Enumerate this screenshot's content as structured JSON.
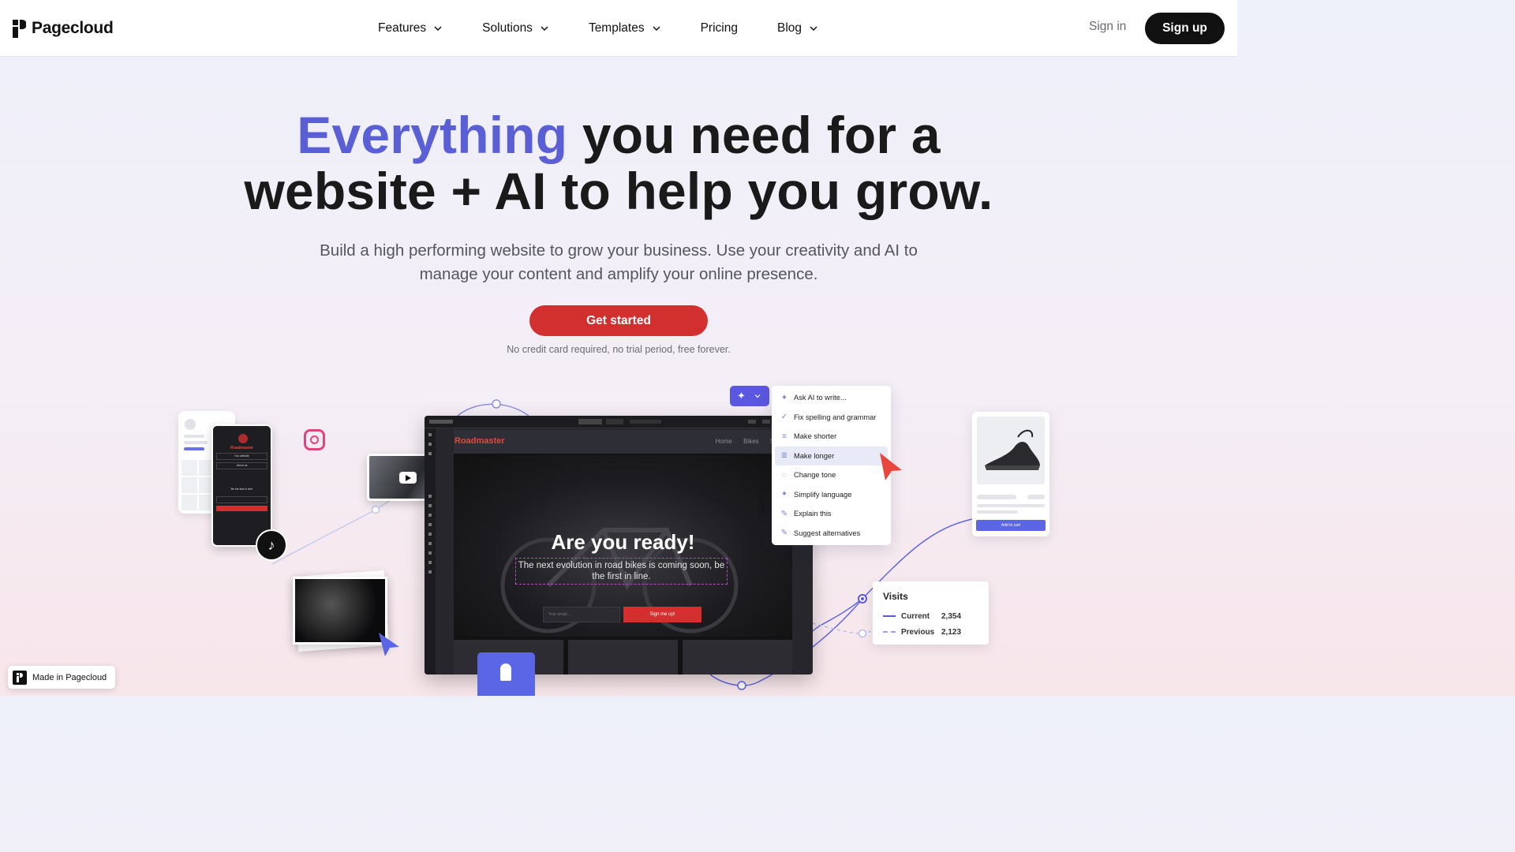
{
  "nav": {
    "brand": "Pagecloud",
    "items": [
      {
        "label": "Features",
        "has_dropdown": true
      },
      {
        "label": "Solutions",
        "has_dropdown": true
      },
      {
        "label": "Templates",
        "has_dropdown": true
      },
      {
        "label": "Pricing",
        "has_dropdown": false
      },
      {
        "label": "Blog",
        "has_dropdown": true
      }
    ],
    "signin": "Sign in",
    "signup": "Sign up"
  },
  "hero": {
    "title_accent": "Everything",
    "title_line1_rest": " you need for a",
    "title_line2": "website + AI to help you grow.",
    "subtitle": "Build a high performing website to grow your business. Use your creativity and AI to manage your content and amplify your online presence.",
    "cta": "Get started",
    "note": "No credit card required, no trial period, free forever."
  },
  "phone": {
    "brand": "Roadmaster",
    "rows": [
      "Our website",
      "About us",
      "Be the first in line!"
    ]
  },
  "editor": {
    "brand": "Roadmaster",
    "links": "Home Bikes Store",
    "headline": "Are you ready!",
    "paragraph": "The next evolution in road bikes is coming soon, be the first in line.",
    "email_placeholder": "Your email...",
    "signup_button": "Sign me up!"
  },
  "ai_menu": {
    "items": [
      {
        "label": "Ask AI to write...",
        "icon": "sparkle-icon"
      },
      {
        "label": "Fix spelling and grammar",
        "icon": "check-icon"
      },
      {
        "label": "Make shorter",
        "icon": "short-lines-icon"
      },
      {
        "label": "Make longer",
        "icon": "long-lines-icon",
        "active": true
      },
      {
        "label": "Change tone",
        "icon": "tone-icon"
      },
      {
        "label": "Simplify language",
        "icon": "sparkle-icon"
      },
      {
        "label": "Explain this",
        "icon": "pencil-icon"
      },
      {
        "label": "Suggest alternatives",
        "icon": "pencil-icon"
      }
    ]
  },
  "product": {
    "button": "Add to cart"
  },
  "visits": {
    "title": "Visits",
    "rows": [
      {
        "label": "Current",
        "value": "2,354"
      },
      {
        "label": "Previous",
        "value": "2,123"
      }
    ]
  },
  "badge": "Made in Pagecloud",
  "colors": {
    "accent": "#5a5fd6",
    "cta": "#d1302e",
    "dark": "#111111"
  }
}
